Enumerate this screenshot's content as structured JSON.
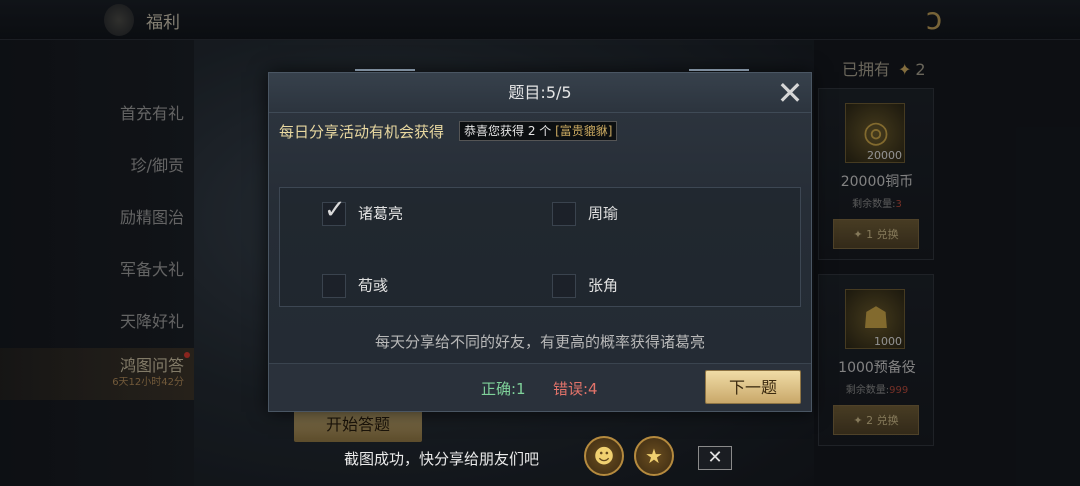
{
  "topbar": {
    "title": "福利",
    "back_icon": "dragon-back-icon"
  },
  "sidebar": {
    "items": [
      {
        "label": "首充有礼"
      },
      {
        "label": "珍/御贡"
      },
      {
        "label": "励精图治"
      },
      {
        "label": "军备大礼"
      },
      {
        "label": "天降好礼"
      },
      {
        "label": "鸿图问答",
        "sub": "6天12小时42分"
      }
    ]
  },
  "main": {
    "start_button": "开始答题"
  },
  "right_panel": {
    "owned_label": "已拥有",
    "owned_count": "2",
    "cards": [
      {
        "name": "20000铜币",
        "qty": "20000",
        "remain_label": "剩余数量:",
        "remain": "3",
        "cost": "1",
        "exchange": "兑换"
      },
      {
        "name": "1000预备役",
        "qty": "1000",
        "remain_label": "剩余数量:",
        "remain": "999",
        "cost": "2",
        "exchange": "兑换"
      }
    ]
  },
  "dialog": {
    "title": "题目:5/5",
    "question": "每日分享活动有机会获得",
    "tooltip": {
      "text": "恭喜您获得 2 个",
      "item": "[富贵貔貅]"
    },
    "options": [
      {
        "label": "诸葛亮",
        "checked": true
      },
      {
        "label": "周瑜",
        "checked": false
      },
      {
        "label": "荀彧",
        "checked": false
      },
      {
        "label": "张角",
        "checked": false
      }
    ],
    "hint": "每天分享给不同的好友，有更高的概率获得诸葛亮",
    "correct": "正确:1",
    "wrong": "错误:4",
    "next_button": "下一题"
  },
  "toast": {
    "text": "截图成功，快分享给朋友们吧",
    "share_targets": [
      "qq-icon",
      "qzone-star-icon"
    ]
  },
  "colors": {
    "accent_gold": "#c9a860",
    "correct_green": "#7fd19a",
    "wrong_red": "#e2736a",
    "question_yellow": "#e8d8a0"
  }
}
